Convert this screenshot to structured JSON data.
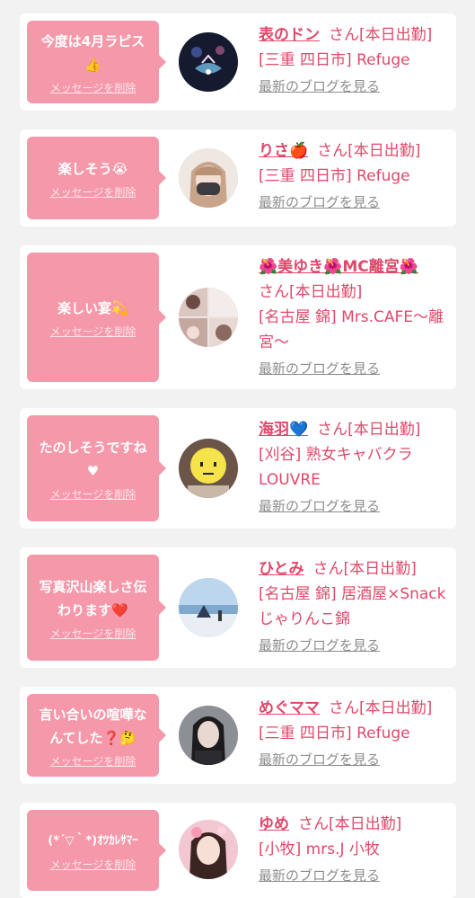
{
  "items": [
    {
      "message": "今度は4月ラピス👍",
      "delete_label": "メッセージを削除",
      "name": "表のドン",
      "suffix": "さん[本日出勤]",
      "shop": "[三重 四日市] Refuge",
      "blog_label": "最新のブログを見る"
    },
    {
      "message": "楽しそう😭",
      "delete_label": "メッセージを削除",
      "name": "りさ🍎",
      "suffix": "さん[本日出勤]",
      "shop": "[三重 四日市] Refuge",
      "blog_label": "最新のブログを見る"
    },
    {
      "message": "楽しい宴💫",
      "delete_label": "メッセージを削除",
      "name": "🌺美ゆき🌺MC離宮🌺",
      "suffix": "さん[本日出勤]",
      "shop": "[名古屋 錦] Mrs.CAFE〜離宮〜",
      "blog_label": "最新のブログを見る"
    },
    {
      "message": "たのしそうですね♥",
      "delete_label": "メッセージを削除",
      "name": "海羽💙",
      "suffix": "さん[本日出勤]",
      "shop": "[刈谷] 熟女キャバクラLOUVRE",
      "blog_label": "最新のブログを見る"
    },
    {
      "message": "写真沢山楽しさ伝わります❤️",
      "delete_label": "メッセージを削除",
      "name": "ひとみ",
      "suffix": "さん[本日出勤]",
      "shop": "[名古屋 錦] 居酒屋×Snack じゃりんこ錦",
      "blog_label": "最新のブログを見る"
    },
    {
      "message": "言い合いの喧嘩なんてした❓🤔",
      "delete_label": "メッセージを削除",
      "name": "めぐママ",
      "suffix": "さん[本日出勤]",
      "shop": "[三重 四日市] Refuge",
      "blog_label": "最新のブログを見る"
    },
    {
      "message": "(*´▽｀*)ｵﾂｶﾚｻﾏｰ",
      "delete_label": "メッセージを削除",
      "name": "ゆめ",
      "suffix": "さん[本日出勤]",
      "shop": "[小牧] mrs.J 小牧",
      "blog_label": "最新のブログを見る"
    }
  ]
}
